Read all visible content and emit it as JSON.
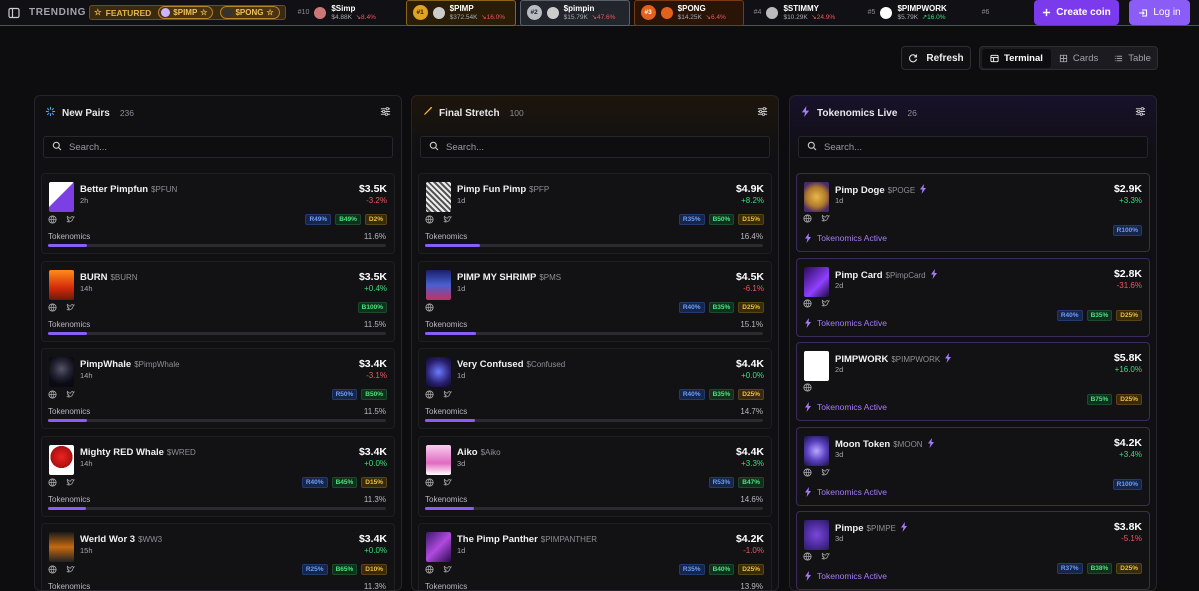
{
  "topbar": {
    "trending_label": "TRENDING",
    "featured_label": "FEATURED",
    "featured_chips": [
      "$PIMP",
      "$PONG"
    ],
    "tickers": [
      {
        "rank": "#10",
        "name": "$Simp",
        "mc": "$4.88K",
        "chg": "8.4%",
        "dir": "dn",
        "style": "plain"
      },
      {
        "rank": "#1",
        "name": "$PIMP",
        "mc": "$372.54K",
        "chg": "16.0%",
        "dir": "dn",
        "style": "gold"
      },
      {
        "rank": "#2",
        "name": "$pimpin",
        "mc": "$15.79K",
        "chg": "47.6%",
        "dir": "dn",
        "style": "silver"
      },
      {
        "rank": "#3",
        "name": "$PONG",
        "mc": "$14.25K",
        "chg": "6.4%",
        "dir": "dn",
        "style": "bronze"
      },
      {
        "rank": "#4",
        "name": "$STIMMY",
        "mc": "$10.29K",
        "chg": "24.9%",
        "dir": "dn",
        "style": "plain"
      },
      {
        "rank": "#5",
        "name": "$PIMPWORK",
        "mc": "$5.79K",
        "chg": "16.0%",
        "dir": "up",
        "style": "plain"
      },
      {
        "rank": "#6",
        "name": "",
        "mc": "",
        "chg": "",
        "dir": "up",
        "style": "plain"
      }
    ],
    "create_label": "Create coin",
    "login_label": "Log in"
  },
  "toolbar": {
    "refresh_label": "Refresh",
    "views": [
      "Terminal",
      "Cards",
      "Table"
    ],
    "active_view": "Terminal"
  },
  "columns": [
    {
      "title": "New Pairs",
      "count": "236",
      "search_placeholder": "Search...",
      "cards": [
        {
          "name": "Better Pimpfun",
          "sym": "$PFUN",
          "age": "2h",
          "mcap": "$3.5K",
          "chg": "-3.2%",
          "dir": "dn",
          "pills": [
            [
              "r",
              "R49%"
            ],
            [
              "b",
              "B49%"
            ],
            [
              "d",
              "D2%"
            ]
          ],
          "tokenomics_label": "Tokenomics",
          "pct": "11.6%",
          "fill": 0.116,
          "art": "pill"
        },
        {
          "name": "BURN",
          "sym": "$BURN",
          "age": "14h",
          "mcap": "$3.5K",
          "chg": "+0.4%",
          "dir": "up",
          "pills": [
            [
              "b",
              "B100%"
            ]
          ],
          "tokenomics_label": "Tokenomics",
          "pct": "11.5%",
          "fill": 0.115,
          "art": "fire"
        },
        {
          "name": "PimpWhale",
          "sym": "$PimpWhale",
          "age": "14h",
          "mcap": "$3.4K",
          "chg": "-3.1%",
          "dir": "dn",
          "pills": [
            [
              "r",
              "R50%"
            ],
            [
              "b",
              "B50%"
            ]
          ],
          "tokenomics_label": "Tokenomics",
          "pct": "11.5%",
          "fill": 0.115,
          "art": "dark"
        },
        {
          "name": "Mighty RED Whale",
          "sym": "$WRED",
          "age": "14h",
          "mcap": "$3.4K",
          "chg": "+0.0%",
          "dir": "up",
          "pills": [
            [
              "r",
              "R40%"
            ],
            [
              "b",
              "B45%"
            ],
            [
              "d",
              "D15%"
            ]
          ],
          "tokenomics_label": "Tokenomics",
          "pct": "11.3%",
          "fill": 0.113,
          "art": "red"
        },
        {
          "name": "Werld Wor 3",
          "sym": "$WW3",
          "age": "15h",
          "mcap": "$3.4K",
          "chg": "+0.0%",
          "dir": "up",
          "pills": [
            [
              "r",
              "R25%"
            ],
            [
              "b",
              "B65%"
            ],
            [
              "d",
              "D10%"
            ]
          ],
          "tokenomics_label": "Tokenomics",
          "pct": "11.3%",
          "fill": 0.113,
          "art": "war"
        }
      ]
    },
    {
      "title": "Final Stretch",
      "count": "100",
      "search_placeholder": "Search...",
      "cards": [
        {
          "name": "Pimp Fun Pimp",
          "sym": "$PFP",
          "age": "1d",
          "mcap": "$4.9K",
          "chg": "+8.2%",
          "dir": "up",
          "pills": [
            [
              "r",
              "R35%"
            ],
            [
              "b",
              "B50%"
            ],
            [
              "d",
              "D15%"
            ]
          ],
          "tokenomics_label": "Tokenomics",
          "pct": "16.4%",
          "fill": 0.164,
          "art": "sketch"
        },
        {
          "name": "PIMP MY SHRIMP",
          "sym": "$PMS",
          "age": "1d",
          "mcap": "$4.5K",
          "chg": "-6.1%",
          "dir": "dn",
          "pills": [
            [
              "r",
              "R40%"
            ],
            [
              "b",
              "B35%"
            ],
            [
              "d",
              "D25%"
            ]
          ],
          "tokenomics_label": "Tokenomics",
          "pct": "15.1%",
          "fill": 0.151,
          "art": "city"
        },
        {
          "name": "Very Confused",
          "sym": "$Confused",
          "age": "1d",
          "mcap": "$4.4K",
          "chg": "+0.0%",
          "dir": "up",
          "pills": [
            [
              "r",
              "R40%"
            ],
            [
              "b",
              "B35%"
            ],
            [
              "d",
              "D25%"
            ]
          ],
          "tokenomics_label": "Tokenomics",
          "pct": "14.7%",
          "fill": 0.147,
          "art": "blue"
        },
        {
          "name": "Aiko",
          "sym": "$Aiko",
          "age": "3d",
          "mcap": "$4.4K",
          "chg": "+3.3%",
          "dir": "up",
          "pills": [
            [
              "r",
              "R53%"
            ],
            [
              "b",
              "B47%"
            ]
          ],
          "tokenomics_label": "Tokenomics",
          "pct": "14.6%",
          "fill": 0.146,
          "art": "pink"
        },
        {
          "name": "The Pimp Panther",
          "sym": "$PIMPANTHER",
          "age": "1d",
          "mcap": "$4.2K",
          "chg": "-1.0%",
          "dir": "dn",
          "pills": [
            [
              "r",
              "R35%"
            ],
            [
              "b",
              "B40%"
            ],
            [
              "d",
              "D25%"
            ]
          ],
          "tokenomics_label": "Tokenomics",
          "pct": "13.9%",
          "fill": 0.139,
          "art": "purple"
        }
      ]
    },
    {
      "title": "Tokenomics Live",
      "count": "26",
      "search_placeholder": "Search...",
      "cards": [
        {
          "name": "Pimp Doge",
          "sym": "$POGE",
          "age": "1d",
          "mcap": "$2.9K",
          "chg": "+3.3%",
          "dir": "up",
          "pills": [
            [
              "r",
              "R100%"
            ]
          ],
          "active_label": "Tokenomics Active",
          "art": "doge"
        },
        {
          "name": "Pimp Card",
          "sym": "$PimpCard",
          "age": "2d",
          "mcap": "$2.8K",
          "chg": "-31.6%",
          "dir": "dn",
          "pills": [
            [
              "r",
              "R40%"
            ],
            [
              "b",
              "B35%"
            ],
            [
              "d",
              "D25%"
            ]
          ],
          "active_label": "Tokenomics Active",
          "art": "card"
        },
        {
          "name": "PIMPWORK",
          "sym": "$PIMPWORK",
          "age": "2d",
          "mcap": "$5.8K",
          "chg": "+16.0%",
          "dir": "up",
          "pills": [
            [
              "b",
              "B75%"
            ],
            [
              "d",
              "D25%"
            ]
          ],
          "active_label": "Tokenomics Active",
          "art": "white"
        },
        {
          "name": "Moon Token",
          "sym": "$MOON",
          "age": "3d",
          "mcap": "$4.2K",
          "chg": "+3.4%",
          "dir": "up",
          "pills": [
            [
              "r",
              "R100%"
            ]
          ],
          "active_label": "Tokenomics Active",
          "art": "moon"
        },
        {
          "name": "Pimpe",
          "sym": "$PIMPE",
          "age": "3d",
          "mcap": "$3.8K",
          "chg": "-5.1%",
          "dir": "dn",
          "pills": [
            [
              "r",
              "R37%"
            ],
            [
              "b",
              "B38%"
            ],
            [
              "d",
              "D25%"
            ]
          ],
          "active_label": "Tokenomics Active",
          "art": "pepe"
        }
      ]
    }
  ]
}
